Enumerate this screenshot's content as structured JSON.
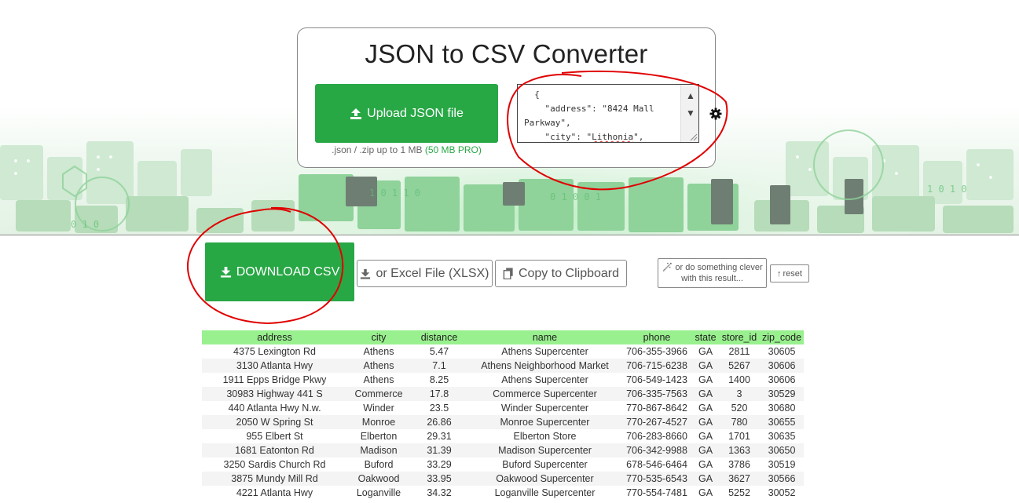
{
  "converter": {
    "title": "JSON to CSV Converter",
    "upload_label": "Upload JSON file",
    "upload_note": ".json / .zip up to 1 MB ",
    "upload_pro": "(50 MB PRO)",
    "json_line1": "  {",
    "json_line2": "    \"address\": \"8424 Mall Parkway\",",
    "json_line3_pre": "    \"city\": \"",
    "json_line3_word": "Lithonia",
    "json_line3_post": "\","
  },
  "actions": {
    "download_label": "DOWNLOAD CSV",
    "xlsx_label": "or Excel File (XLSX)",
    "clipboard_label": "Copy to Clipboard",
    "clever_label": "or do something clever with this result...",
    "reset_label": "reset"
  },
  "table": {
    "columns": [
      "address",
      "city",
      "distance",
      "name",
      "phone",
      "state",
      "store_id",
      "zip_code"
    ],
    "rows": [
      [
        "4375 Lexington Rd",
        "Athens",
        "5.47",
        "Athens Supercenter",
        "706-355-3966",
        "GA",
        "2811",
        "30605"
      ],
      [
        "3130 Atlanta Hwy",
        "Athens",
        "7.1",
        "Athens Neighborhood Market",
        "706-715-6238",
        "GA",
        "5267",
        "30606"
      ],
      [
        "1911 Epps Bridge Pkwy",
        "Athens",
        "8.25",
        "Athens Supercenter",
        "706-549-1423",
        "GA",
        "1400",
        "30606"
      ],
      [
        "30983 Highway 441 S",
        "Commerce",
        "17.8",
        "Commerce Supercenter",
        "706-335-7563",
        "GA",
        "3",
        "30529"
      ],
      [
        "440 Atlanta Hwy N.w.",
        "Winder",
        "23.5",
        "Winder Supercenter",
        "770-867-8642",
        "GA",
        "520",
        "30680"
      ],
      [
        "2050 W Spring St",
        "Monroe",
        "26.86",
        "Monroe Supercenter",
        "770-267-4527",
        "GA",
        "780",
        "30655"
      ],
      [
        "955 Elbert St",
        "Elberton",
        "29.31",
        "Elberton Store",
        "706-283-8660",
        "GA",
        "1701",
        "30635"
      ],
      [
        "1681 Eatonton Rd",
        "Madison",
        "31.39",
        "Madison Supercenter",
        "706-342-9988",
        "GA",
        "1363",
        "30650"
      ],
      [
        "3250 Sardis Church Rd",
        "Buford",
        "33.29",
        "Buford Supercenter",
        "678-546-6464",
        "GA",
        "3786",
        "30519"
      ],
      [
        "3875 Mundy Mill Rd",
        "Oakwood",
        "33.95",
        "Oakwood Supercenter",
        "770-535-6543",
        "GA",
        "3627",
        "30566"
      ],
      [
        "4221 Atlanta Hwy",
        "Loganville",
        "34.32",
        "Loganville Supercenter",
        "770-554-7481",
        "GA",
        "5252",
        "30052"
      ]
    ]
  },
  "colors": {
    "accent_green": "#28a745",
    "table_header": "#99f08e",
    "annotation_red": "#e00000"
  },
  "icons": {
    "upload": "upload-icon",
    "download": "download-icon",
    "clipboard": "clipboard-icon",
    "settings": "gear-icon",
    "magic": "magic-wand-icon",
    "reset": "arrow-up-icon"
  }
}
